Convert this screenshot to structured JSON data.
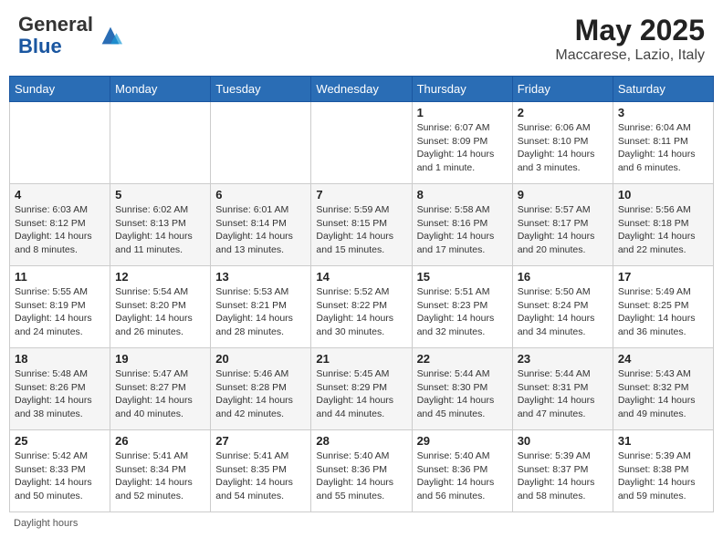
{
  "header": {
    "logo_general": "General",
    "logo_blue": "Blue",
    "title": "May 2025",
    "location": "Maccarese, Lazio, Italy"
  },
  "days_of_week": [
    "Sunday",
    "Monday",
    "Tuesday",
    "Wednesday",
    "Thursday",
    "Friday",
    "Saturday"
  ],
  "weeks": [
    [
      {
        "day": "",
        "info": ""
      },
      {
        "day": "",
        "info": ""
      },
      {
        "day": "",
        "info": ""
      },
      {
        "day": "",
        "info": ""
      },
      {
        "day": "1",
        "info": "Sunrise: 6:07 AM\nSunset: 8:09 PM\nDaylight: 14 hours\nand 1 minute."
      },
      {
        "day": "2",
        "info": "Sunrise: 6:06 AM\nSunset: 8:10 PM\nDaylight: 14 hours\nand 3 minutes."
      },
      {
        "day": "3",
        "info": "Sunrise: 6:04 AM\nSunset: 8:11 PM\nDaylight: 14 hours\nand 6 minutes."
      }
    ],
    [
      {
        "day": "4",
        "info": "Sunrise: 6:03 AM\nSunset: 8:12 PM\nDaylight: 14 hours\nand 8 minutes."
      },
      {
        "day": "5",
        "info": "Sunrise: 6:02 AM\nSunset: 8:13 PM\nDaylight: 14 hours\nand 11 minutes."
      },
      {
        "day": "6",
        "info": "Sunrise: 6:01 AM\nSunset: 8:14 PM\nDaylight: 14 hours\nand 13 minutes."
      },
      {
        "day": "7",
        "info": "Sunrise: 5:59 AM\nSunset: 8:15 PM\nDaylight: 14 hours\nand 15 minutes."
      },
      {
        "day": "8",
        "info": "Sunrise: 5:58 AM\nSunset: 8:16 PM\nDaylight: 14 hours\nand 17 minutes."
      },
      {
        "day": "9",
        "info": "Sunrise: 5:57 AM\nSunset: 8:17 PM\nDaylight: 14 hours\nand 20 minutes."
      },
      {
        "day": "10",
        "info": "Sunrise: 5:56 AM\nSunset: 8:18 PM\nDaylight: 14 hours\nand 22 minutes."
      }
    ],
    [
      {
        "day": "11",
        "info": "Sunrise: 5:55 AM\nSunset: 8:19 PM\nDaylight: 14 hours\nand 24 minutes."
      },
      {
        "day": "12",
        "info": "Sunrise: 5:54 AM\nSunset: 8:20 PM\nDaylight: 14 hours\nand 26 minutes."
      },
      {
        "day": "13",
        "info": "Sunrise: 5:53 AM\nSunset: 8:21 PM\nDaylight: 14 hours\nand 28 minutes."
      },
      {
        "day": "14",
        "info": "Sunrise: 5:52 AM\nSunset: 8:22 PM\nDaylight: 14 hours\nand 30 minutes."
      },
      {
        "day": "15",
        "info": "Sunrise: 5:51 AM\nSunset: 8:23 PM\nDaylight: 14 hours\nand 32 minutes."
      },
      {
        "day": "16",
        "info": "Sunrise: 5:50 AM\nSunset: 8:24 PM\nDaylight: 14 hours\nand 34 minutes."
      },
      {
        "day": "17",
        "info": "Sunrise: 5:49 AM\nSunset: 8:25 PM\nDaylight: 14 hours\nand 36 minutes."
      }
    ],
    [
      {
        "day": "18",
        "info": "Sunrise: 5:48 AM\nSunset: 8:26 PM\nDaylight: 14 hours\nand 38 minutes."
      },
      {
        "day": "19",
        "info": "Sunrise: 5:47 AM\nSunset: 8:27 PM\nDaylight: 14 hours\nand 40 minutes."
      },
      {
        "day": "20",
        "info": "Sunrise: 5:46 AM\nSunset: 8:28 PM\nDaylight: 14 hours\nand 42 minutes."
      },
      {
        "day": "21",
        "info": "Sunrise: 5:45 AM\nSunset: 8:29 PM\nDaylight: 14 hours\nand 44 minutes."
      },
      {
        "day": "22",
        "info": "Sunrise: 5:44 AM\nSunset: 8:30 PM\nDaylight: 14 hours\nand 45 minutes."
      },
      {
        "day": "23",
        "info": "Sunrise: 5:44 AM\nSunset: 8:31 PM\nDaylight: 14 hours\nand 47 minutes."
      },
      {
        "day": "24",
        "info": "Sunrise: 5:43 AM\nSunset: 8:32 PM\nDaylight: 14 hours\nand 49 minutes."
      }
    ],
    [
      {
        "day": "25",
        "info": "Sunrise: 5:42 AM\nSunset: 8:33 PM\nDaylight: 14 hours\nand 50 minutes."
      },
      {
        "day": "26",
        "info": "Sunrise: 5:41 AM\nSunset: 8:34 PM\nDaylight: 14 hours\nand 52 minutes."
      },
      {
        "day": "27",
        "info": "Sunrise: 5:41 AM\nSunset: 8:35 PM\nDaylight: 14 hours\nand 54 minutes."
      },
      {
        "day": "28",
        "info": "Sunrise: 5:40 AM\nSunset: 8:36 PM\nDaylight: 14 hours\nand 55 minutes."
      },
      {
        "day": "29",
        "info": "Sunrise: 5:40 AM\nSunset: 8:36 PM\nDaylight: 14 hours\nand 56 minutes."
      },
      {
        "day": "30",
        "info": "Sunrise: 5:39 AM\nSunset: 8:37 PM\nDaylight: 14 hours\nand 58 minutes."
      },
      {
        "day": "31",
        "info": "Sunrise: 5:39 AM\nSunset: 8:38 PM\nDaylight: 14 hours\nand 59 minutes."
      }
    ]
  ],
  "footer": "Daylight hours"
}
